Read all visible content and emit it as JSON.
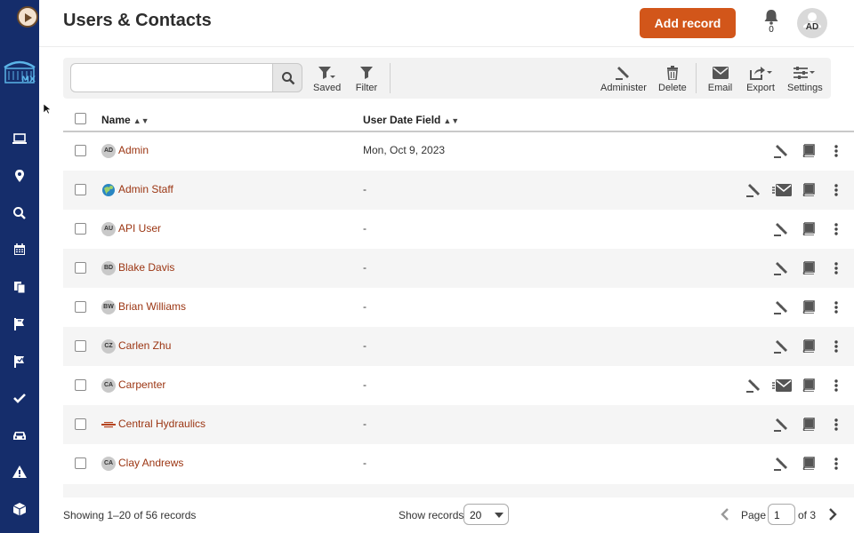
{
  "header": {
    "title": "Users & Contacts",
    "add_button": "Add record",
    "notification_count": "0",
    "avatar_initials": "AD"
  },
  "toolbar": {
    "search_placeholder": "",
    "saved": "Saved",
    "filter": "Filter",
    "administer": "Administer",
    "delete": "Delete",
    "email": "Email",
    "export": "Export",
    "settings": "Settings"
  },
  "table": {
    "col_name": "Name",
    "col_date": "User Date Field",
    "rows": [
      {
        "initials": "AD",
        "name": "Admin",
        "date": "Mon, Oct 9, 2023",
        "mail": false,
        "avatar": "initials"
      },
      {
        "initials": "",
        "name": "Admin Staff",
        "date": "-",
        "mail": true,
        "avatar": "globe"
      },
      {
        "initials": "AU",
        "name": "API User",
        "date": "-",
        "mail": false,
        "avatar": "initials"
      },
      {
        "initials": "BD",
        "name": "Blake Davis",
        "date": "-",
        "mail": false,
        "avatar": "initials"
      },
      {
        "initials": "BW",
        "name": "Brian Williams",
        "date": "-",
        "mail": false,
        "avatar": "initials"
      },
      {
        "initials": "CZ",
        "name": "Carlen Zhu",
        "date": "-",
        "mail": false,
        "avatar": "initials"
      },
      {
        "initials": "CA",
        "name": "Carpenter",
        "date": "-",
        "mail": true,
        "avatar": "initials"
      },
      {
        "initials": "",
        "name": "Central Hydraulics",
        "date": "-",
        "mail": false,
        "avatar": "logo"
      },
      {
        "initials": "CA",
        "name": "Clay Andrews",
        "date": "-",
        "mail": false,
        "avatar": "initials"
      }
    ]
  },
  "footer": {
    "showing": "Showing 1–20 of 56 records",
    "show_records": "Show records",
    "page_size": "20",
    "page_label": "Page",
    "page_value": "1",
    "of_label": "of 3"
  },
  "colors": {
    "sidebar": "#152d6b",
    "accent": "#d2561a",
    "link": "#9b3512"
  }
}
